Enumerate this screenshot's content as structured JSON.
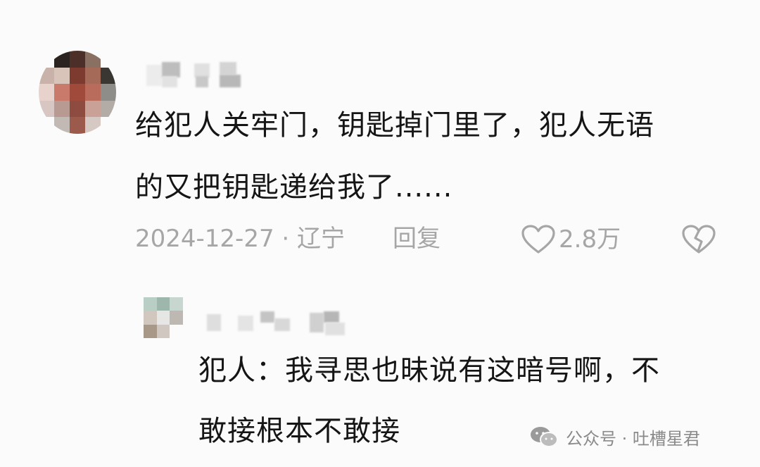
{
  "comment": {
    "text_lines": [
      "给犯人关牢门，钥匙掉门里了，犯人无语",
      "的又把钥匙递给我了......"
    ],
    "date_location": "2024-12-27 · 辽宁",
    "reply_label": "回复",
    "like_count": "2.8万",
    "like_icon": "heart-outline-icon",
    "dislike_icon": "broken-heart-icon"
  },
  "reply": {
    "text_lines": [
      "犯人：我寻思也昧说有这暗号啊，不",
      "敢接根本不敢接"
    ]
  },
  "watermark": {
    "icon": "wechat-icon",
    "text": "公众号 · 吐槽星君"
  },
  "colors": {
    "background": "#fbfbfb",
    "text": "#151515",
    "meta": "#a6a6a6",
    "watermark": "#8a8a8a"
  }
}
